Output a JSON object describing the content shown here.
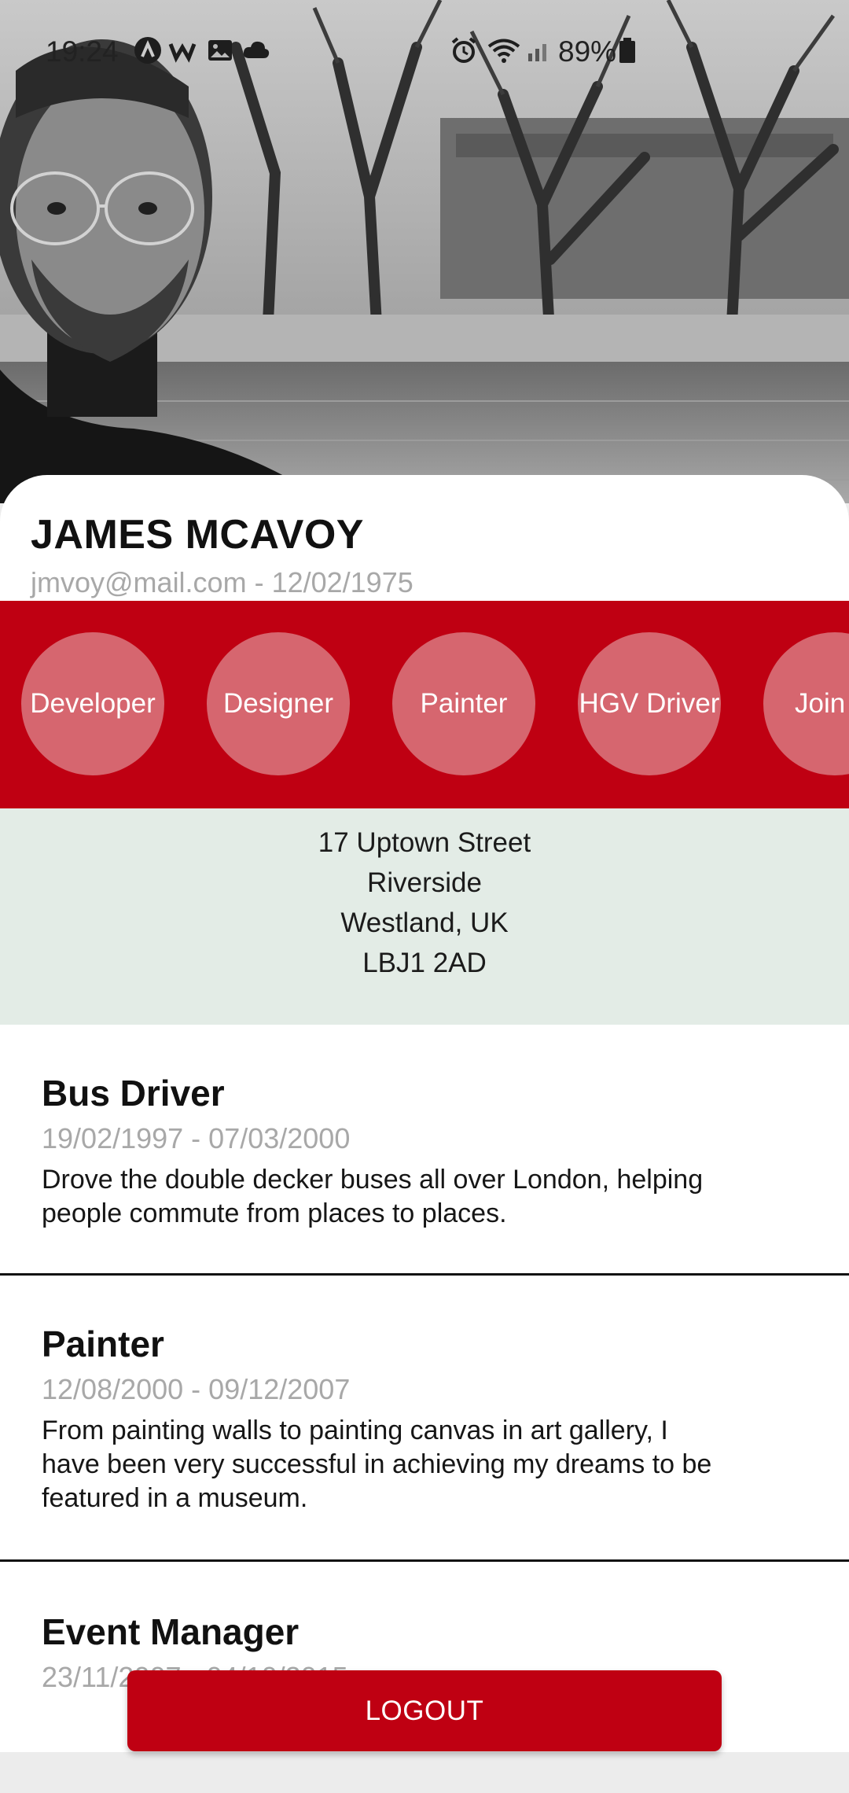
{
  "status_bar": {
    "time": "19:24",
    "battery": "89%",
    "icons": [
      "app-a-icon",
      "w-app-icon",
      "gallery-icon",
      "cloud-icon",
      "alarm-icon",
      "wifi-icon",
      "signal-icon",
      "battery-icon"
    ]
  },
  "hero": {
    "image": "profile-photo"
  },
  "profile": {
    "name": "JAMES MCAVOY",
    "meta": "jmvoy@mail.com - 12/02/1975"
  },
  "skills": [
    "Developer",
    "Designer",
    "Painter",
    "HGV Driver",
    "Join"
  ],
  "address": {
    "line1": "17 Uptown Street",
    "line2": "Riverside",
    "line3": "Westland, UK",
    "line4": "LBJ1 2AD"
  },
  "experience": [
    {
      "title": "Bus Driver",
      "dates": "19/02/1997 - 07/03/2000",
      "desc_line1": "Drove the double decker buses all over  London, helping",
      "desc_line2": "people commute from places to places."
    },
    {
      "title": "Painter",
      "dates": "12/08/2000 - 09/12/2007",
      "desc_line1": "From painting walls to painting canvas in art gallery, I",
      "desc_line2": "have been very successful in achieving my dreams to be",
      "desc_line3": "featured in a museum."
    },
    {
      "title": "Event Manager",
      "dates": "23/11/2007 - 04/10/2015"
    }
  ],
  "logout_label": "LOGOUT",
  "colors": {
    "brand_red": "#bf0012",
    "chip_pink": "#d6666f",
    "address_bg": "#e3ece6",
    "muted_text": "#a8a8a8"
  }
}
